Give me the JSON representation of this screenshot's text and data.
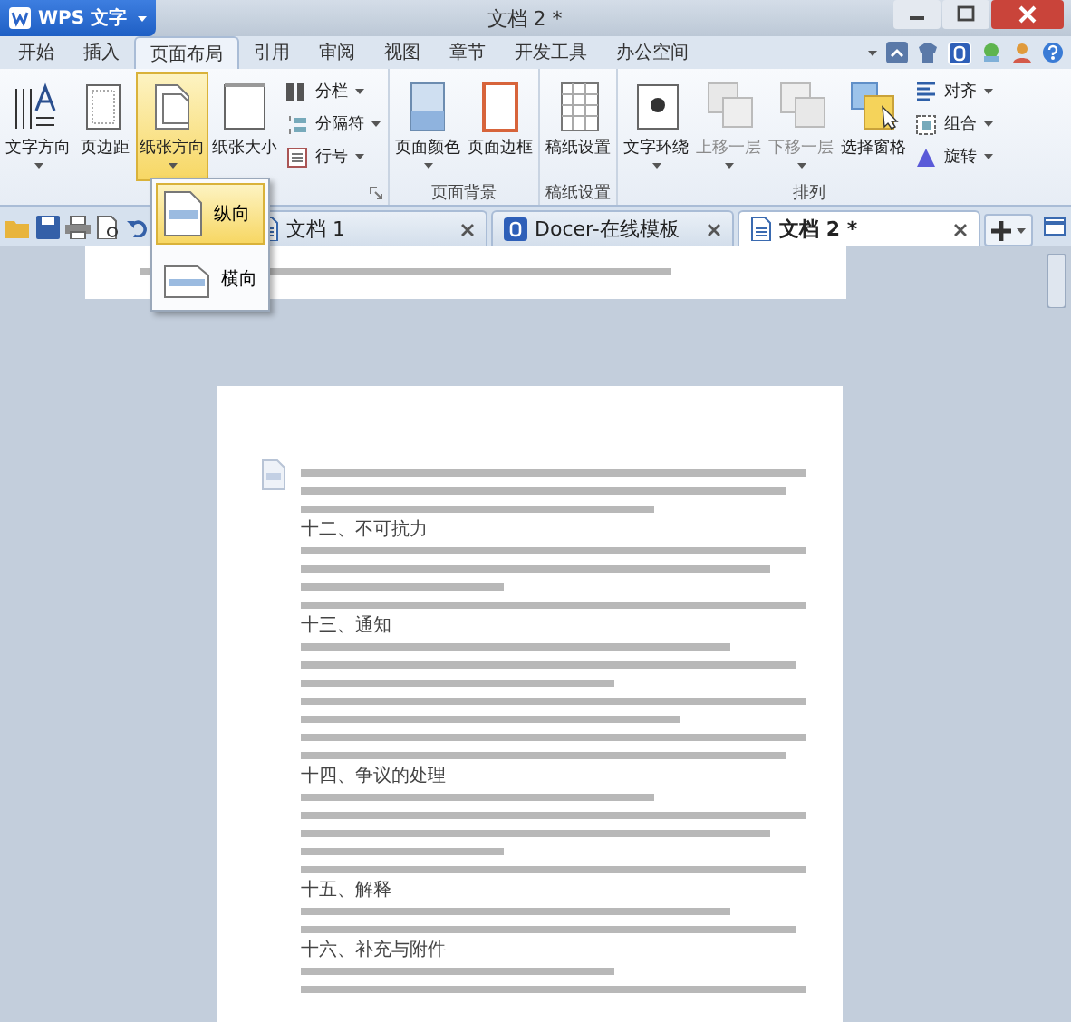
{
  "app_button": {
    "label": "WPS 文字"
  },
  "window": {
    "title": "文档 2 *"
  },
  "menu_tabs": [
    {
      "label": "开始",
      "selected": false
    },
    {
      "label": "插入",
      "selected": false
    },
    {
      "label": "页面布局",
      "selected": true
    },
    {
      "label": "引用",
      "selected": false
    },
    {
      "label": "审阅",
      "selected": false
    },
    {
      "label": "视图",
      "selected": false
    },
    {
      "label": "章节",
      "selected": false
    },
    {
      "label": "开发工具",
      "selected": false
    },
    {
      "label": "办公空间",
      "selected": false
    }
  ],
  "ribbon": {
    "groups": [
      {
        "launcher": true,
        "items": [
          {
            "kind": "large",
            "label": "文字方向",
            "dropdown": true,
            "active": false,
            "disabled": false
          },
          {
            "kind": "large",
            "label": "页边距",
            "dropdown": false,
            "active": false,
            "disabled": false
          },
          {
            "kind": "large",
            "label": "纸张方向",
            "dropdown": true,
            "active": true,
            "disabled": false
          },
          {
            "kind": "large",
            "label": "纸张大小",
            "dropdown": false,
            "active": false,
            "disabled": false
          },
          {
            "kind": "stack",
            "items": [
              {
                "label": "分栏",
                "dropdown": true
              },
              {
                "label": "分隔符",
                "dropdown": true
              },
              {
                "label": "行号",
                "dropdown": true
              }
            ]
          }
        ]
      },
      {
        "label": "页面背景",
        "launcher": false,
        "items": [
          {
            "kind": "large",
            "label": "页面颜色",
            "dropdown": true,
            "active": false,
            "disabled": false
          },
          {
            "kind": "large",
            "label": "页面边框",
            "dropdown": false,
            "active": false,
            "disabled": false
          }
        ]
      },
      {
        "label": "稿纸设置",
        "launcher": false,
        "items": [
          {
            "kind": "large",
            "label": "稿纸设置",
            "dropdown": false,
            "active": false,
            "disabled": false
          }
        ]
      },
      {
        "label": "排列",
        "launcher": false,
        "items": [
          {
            "kind": "large",
            "label": "文字环绕",
            "dropdown": true,
            "active": false,
            "disabled": false
          },
          {
            "kind": "large",
            "label": "上移一层",
            "dropdown": true,
            "active": false,
            "disabled": true
          },
          {
            "kind": "large",
            "label": "下移一层",
            "dropdown": true,
            "active": false,
            "disabled": true
          },
          {
            "kind": "large",
            "label": "选择窗格",
            "dropdown": false,
            "active": false,
            "disabled": false
          },
          {
            "kind": "stack",
            "items": [
              {
                "label": "对齐",
                "dropdown": true
              },
              {
                "label": "组合",
                "dropdown": true
              },
              {
                "label": "旋转",
                "dropdown": true
              }
            ]
          }
        ]
      }
    ]
  },
  "orientation_menu": {
    "items": [
      {
        "label": "纵向",
        "selected": true
      },
      {
        "label": "横向",
        "selected": false
      }
    ]
  },
  "doc_tabs": [
    {
      "label": "文档 1",
      "selected": false
    },
    {
      "label": "Docer-在线模板",
      "selected": false
    },
    {
      "label": "文档 2 *",
      "selected": true
    }
  ],
  "document": {
    "page_2_headings": [
      "十二、不可抗力",
      "十三、通知",
      "十四、争议的处理",
      "十五、解释",
      "十六、补充与附件"
    ]
  }
}
